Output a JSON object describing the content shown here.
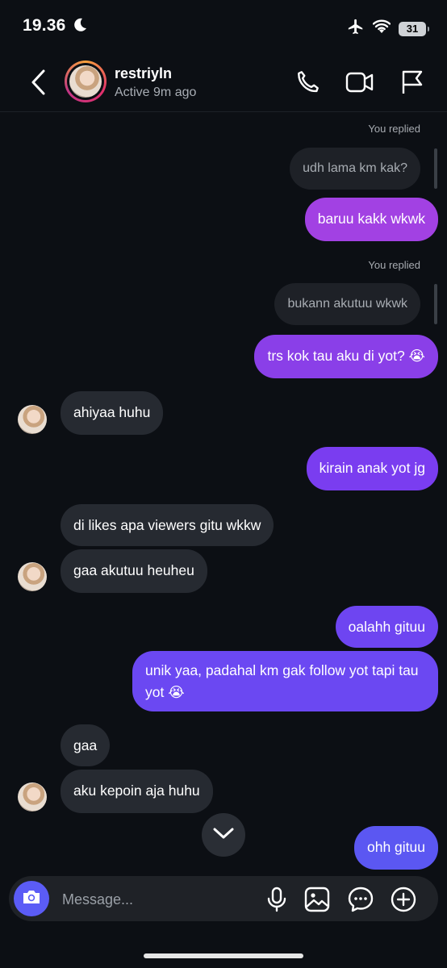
{
  "status_bar": {
    "time": "19.36",
    "battery": "31"
  },
  "header": {
    "username": "restriyln",
    "status": "Active 9m ago"
  },
  "messages": {
    "m1_meta": "You replied",
    "m1_quote": "udh lama km kak?",
    "m1_text": "baruu kakk wkwk",
    "m2_meta": "You replied",
    "m2_quote": "bukann akutuu wkwk",
    "m2_text": "trs kok tau aku di yot? 😭",
    "m3": "ahiyaa huhu",
    "m4": "kirain anak yot jg",
    "m5": "di likes apa viewers gitu wkkw",
    "m6": "gaa akutuu heuheu",
    "m7": "oalahh gituu",
    "m8": "unik yaa, padahal km gak follow yot tapi tau yot 😭",
    "m9": "gaa",
    "m10": "aku kepoin aja huhu",
    "m11": "ohh gituu"
  },
  "composer": {
    "placeholder": "Message..."
  },
  "colors": {
    "sent_top": "#a241e3",
    "sent_mid": "#7b3df0",
    "sent_bottom": "#5b57f2",
    "received": "#262a31",
    "camera": "#5b5cf6"
  }
}
